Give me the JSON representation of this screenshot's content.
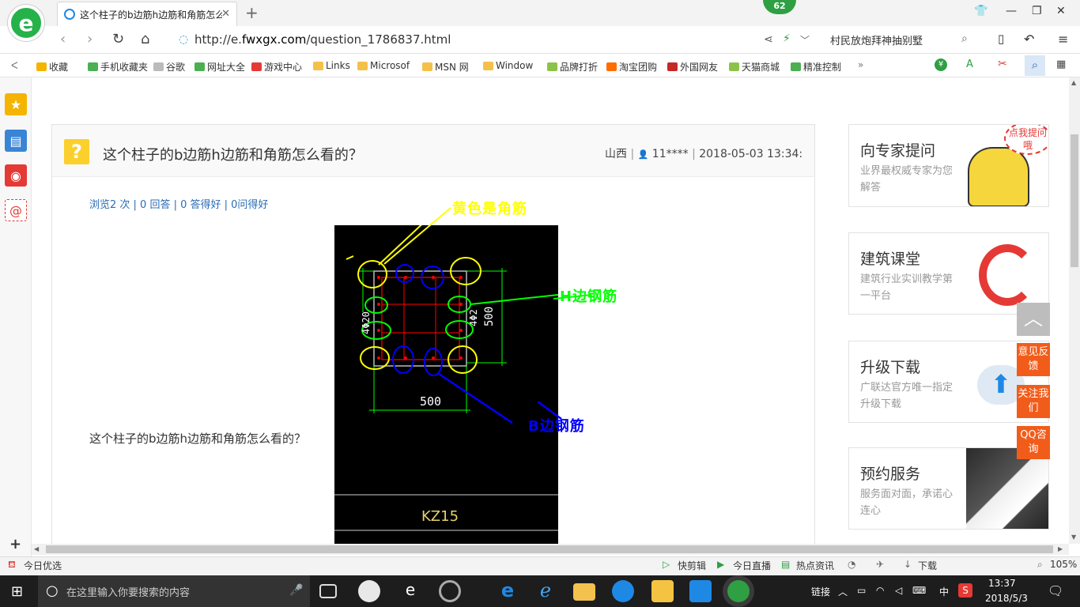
{
  "browser": {
    "tab_title": "这个柱子的b边筋h边筋和角筋怎么",
    "badge_count": "62",
    "url_prefix": "http://e.",
    "url_domain": "fwxgx.com",
    "url_path": "/question_1786837.html",
    "search_text": "村民放炮拜神抽别墅"
  },
  "favorites": [
    {
      "label": "收藏",
      "color": "#f5b400"
    },
    {
      "label": "手机收藏夹",
      "color": "#4caf50"
    },
    {
      "label": "谷歌",
      "color": "#bbbbbb"
    },
    {
      "label": "网址大全",
      "color": "#4caf50"
    },
    {
      "label": "游戏中心",
      "color": "#e53935"
    },
    {
      "label": "Links",
      "color": "#f5c04a"
    },
    {
      "label": "Microsof",
      "color": "#f5c04a"
    },
    {
      "label": "MSN 网",
      "color": "#f5c04a"
    },
    {
      "label": "Window",
      "color": "#f5c04a"
    },
    {
      "label": "品牌打折",
      "color": "#8bc34a"
    },
    {
      "label": "淘宝团购",
      "color": "#ff6d00"
    },
    {
      "label": "外国网友",
      "color": "#c62828"
    },
    {
      "label": "天猫商城",
      "color": "#8bc34a"
    },
    {
      "label": "精准控制",
      "color": "#4caf50"
    }
  ],
  "question": {
    "title": "这个柱子的b边筋h边筋和角筋怎么看的？",
    "location": "山西",
    "user": "11****",
    "datetime": "2018-05-03 13:34:5",
    "stats": "浏览2 次 | 0 回答 | 0 答得好 | 0问得好",
    "body": "这个柱子的b边筋h边筋和角筋怎么看的？"
  },
  "drawing": {
    "annot_corner": "黄色是角筋",
    "annot_h": "H边钢筋",
    "annot_b": "B边钢筋",
    "dim_bottom": "500",
    "dim_right": "500",
    "label_left": "4Φ20",
    "label_right": "4Φ2",
    "column_name": "KZ15",
    "colors": {
      "yellow": "#ffff00",
      "green": "#00ff00",
      "blue": "#0000ff",
      "red": "#ff0000"
    }
  },
  "right_cards": [
    {
      "title": "向专家提问",
      "desc": "业界最权威专家为您解答",
      "bubble": "点我提问哦"
    },
    {
      "title": "建筑课堂",
      "desc": "建筑行业实训教学第一平台"
    },
    {
      "title": "升级下载",
      "desc": "广联达官方唯一指定升级下载"
    },
    {
      "title": "预约服务",
      "desc": "服务面对面，承诺心连心"
    }
  ],
  "float_buttons": [
    "意见反馈",
    "关注我们",
    "QQ咨询"
  ],
  "statusbar": {
    "left": "今日优选",
    "items": [
      "快剪辑",
      "今日直播",
      "热点资讯",
      "下载"
    ],
    "zoom": "105%"
  },
  "taskbar": {
    "search_placeholder": "在这里输入你要搜索的内容",
    "link_label": "链接",
    "ime": "中",
    "time": "13:37",
    "date": "2018/5/3"
  }
}
